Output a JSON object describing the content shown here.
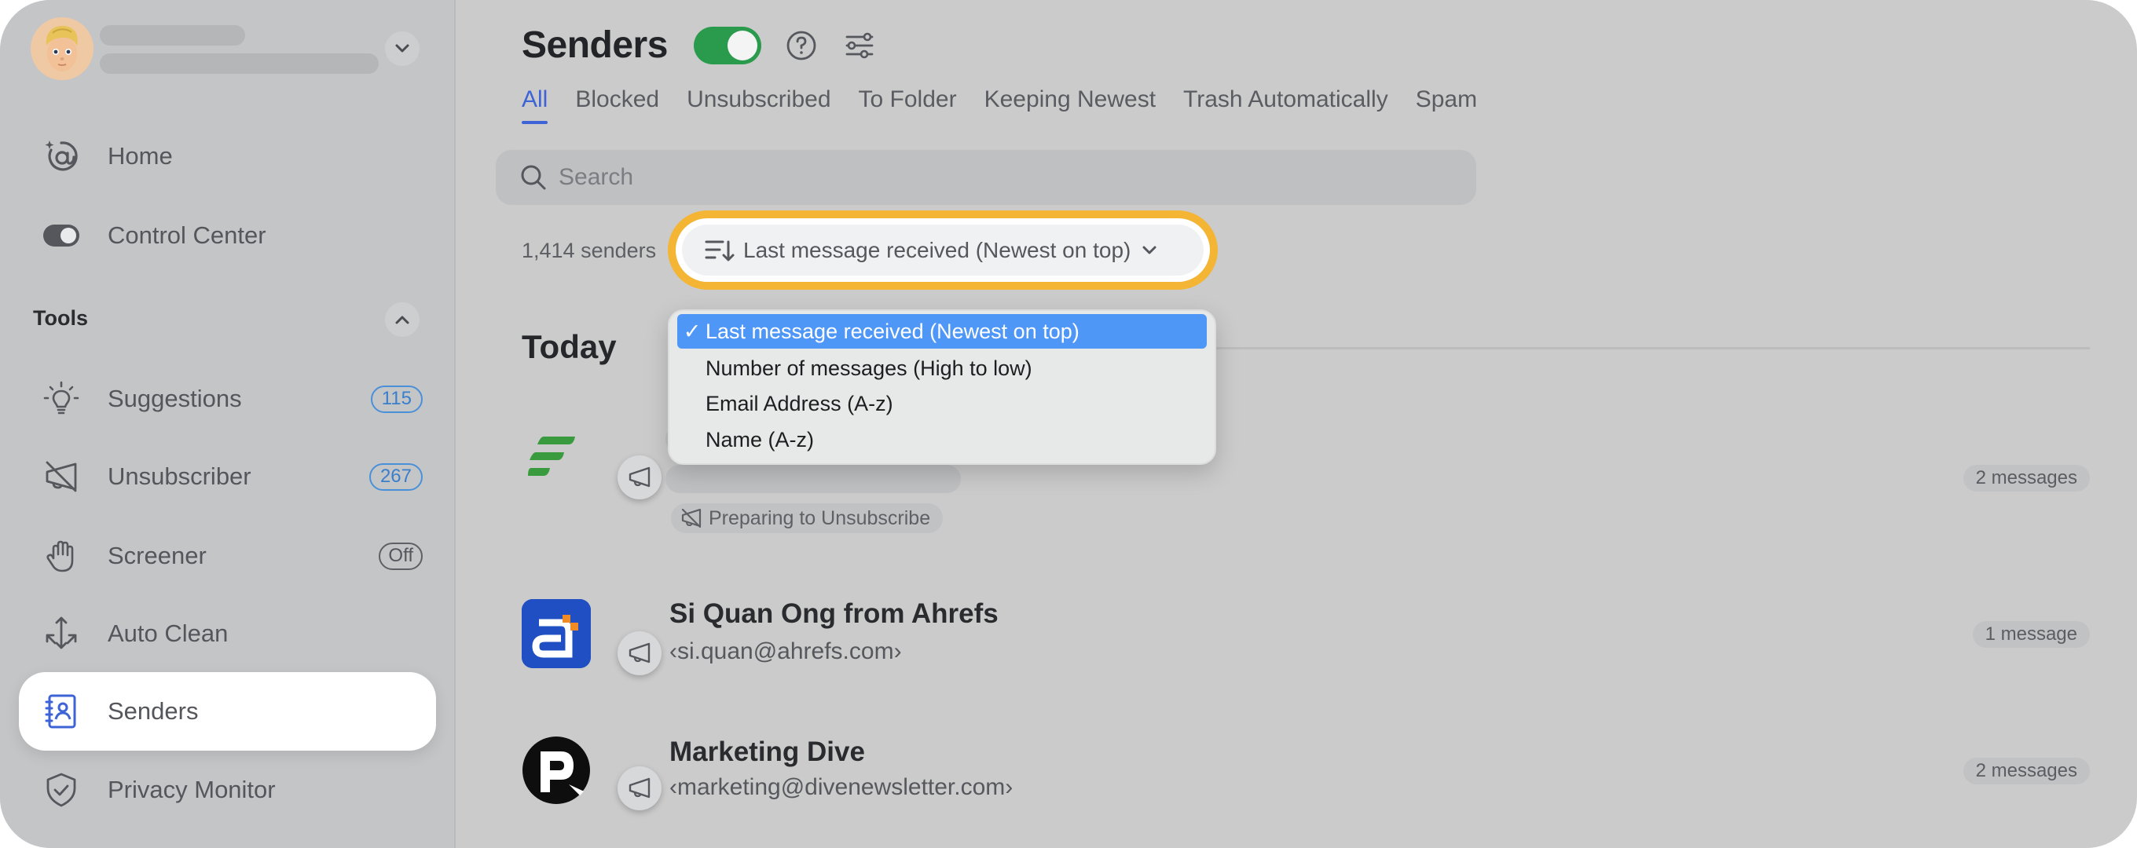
{
  "sidebar": {
    "account": {
      "name_redacted": true,
      "email_redacted": true
    },
    "nav": [
      {
        "key": "home",
        "label": "Home",
        "icon": "at-sparkle-icon"
      },
      {
        "key": "control-center",
        "label": "Control Center",
        "icon": "toggle-icon"
      }
    ],
    "tools_section": {
      "label": "Tools",
      "items": [
        {
          "key": "suggestions",
          "label": "Suggestions",
          "icon": "lightbulb-icon",
          "badge": "115"
        },
        {
          "key": "unsubscriber",
          "label": "Unsubscriber",
          "icon": "megaphone-off-icon",
          "badge": "267"
        },
        {
          "key": "screener",
          "label": "Screener",
          "icon": "hand-icon",
          "badge": "Off"
        },
        {
          "key": "auto-clean",
          "label": "Auto Clean",
          "icon": "auto-clean-arrows-icon"
        },
        {
          "key": "senders",
          "label": "Senders",
          "icon": "contacts-book-icon",
          "active": true
        },
        {
          "key": "privacy-monitor",
          "label": "Privacy Monitor",
          "icon": "shield-check-icon"
        }
      ]
    }
  },
  "header": {
    "title": "Senders",
    "toggle_on": true,
    "help_icon": "question-circle-icon",
    "filter_icon": "sliders-icon"
  },
  "tabs": [
    {
      "label": "All",
      "active": true
    },
    {
      "label": "Blocked"
    },
    {
      "label": "Unsubscribed"
    },
    {
      "label": "To Folder"
    },
    {
      "label": "Keeping Newest"
    },
    {
      "label": "Trash Automatically"
    },
    {
      "label": "Spam"
    }
  ],
  "search": {
    "placeholder": "Search",
    "value": ""
  },
  "list_meta": {
    "count": "1,414 senders",
    "sort_selected": "Last message received (Newest on top)"
  },
  "sort_menu": {
    "options": [
      {
        "label": "Last message received (Newest on top)",
        "selected": true,
        "check": "✓"
      },
      {
        "label": "Number of messages (High to low)"
      },
      {
        "label": "Email Address (A-z)"
      },
      {
        "label": "Name (A-z)"
      }
    ]
  },
  "groups": [
    {
      "label": "Today",
      "senders": [
        {
          "name_redacted": true,
          "email_redacted": true,
          "status_chip": "Preparing to Unsubscribe",
          "messages": "2 messages"
        },
        {
          "name": "Si Quan Ong from Ahrefs",
          "email": "‹si.quan@ahrefs.com›",
          "messages": "1 message"
        },
        {
          "name": "Marketing Dive",
          "email": "‹marketing@divenewsletter.com›",
          "messages": "2 messages"
        }
      ]
    }
  ],
  "colors": {
    "accent_blue": "#3d63d6",
    "toggle_green": "#2a9a4d",
    "focus_ring": "#f3b533",
    "menu_highlight": "#4f97f7",
    "badge_blue": "#4a90d9"
  }
}
